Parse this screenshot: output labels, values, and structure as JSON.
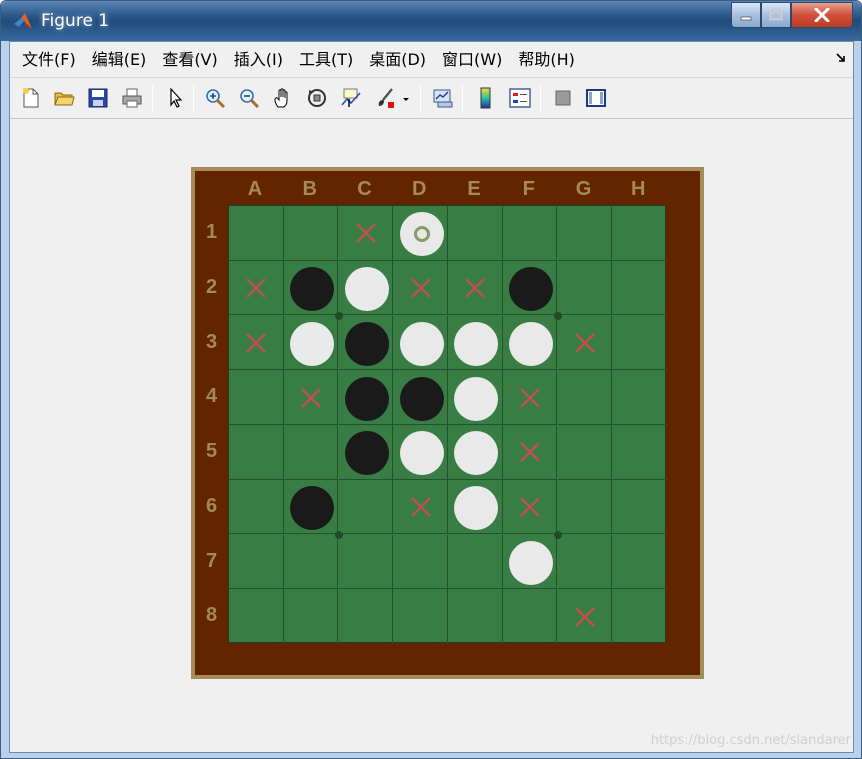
{
  "window": {
    "title": "Figure 1"
  },
  "menu": [
    {
      "id": "file",
      "label": "文件(F)"
    },
    {
      "id": "edit",
      "label": "编辑(E)"
    },
    {
      "id": "view",
      "label": "查看(V)"
    },
    {
      "id": "insert",
      "label": "插入(I)"
    },
    {
      "id": "tools",
      "label": "工具(T)"
    },
    {
      "id": "desktop",
      "label": "桌面(D)"
    },
    {
      "id": "window",
      "label": "窗口(W)"
    },
    {
      "id": "help",
      "label": "帮助(H)"
    }
  ],
  "toolbar": [
    "new-figure-icon",
    "open-file-icon",
    "save-icon",
    "print-icon",
    "pointer-icon",
    "zoom-in-icon",
    "zoom-out-icon",
    "pan-icon",
    "rotate-3d-icon",
    "data-cursor-icon",
    "brush-icon",
    "link-plot-icon",
    "colorbar-icon",
    "legend-icon",
    "hide-plot-tools-icon",
    "show-plot-tools-icon"
  ],
  "board": {
    "columns": [
      "A",
      "B",
      "C",
      "D",
      "E",
      "F",
      "G",
      "H"
    ],
    "rows": [
      "1",
      "2",
      "3",
      "4",
      "5",
      "6",
      "7",
      "8"
    ],
    "colors": {
      "frame": "#a58c5a",
      "wood": "#632400",
      "felt": "#387d44",
      "label": "#a58a55",
      "black_disc": "#1a1a1a",
      "white_disc": "#e9e9e9",
      "hint_mark": "#c0504d",
      "last_move_ring": "#8c9a6a"
    },
    "black_discs": [
      "B2",
      "F2",
      "C3",
      "C4",
      "D4",
      "C5",
      "B6"
    ],
    "white_discs": [
      "D1",
      "C2",
      "B3",
      "D3",
      "E3",
      "F3",
      "E4",
      "D5",
      "E5",
      "E6",
      "F7"
    ],
    "last_move": "D1",
    "hint_marks": [
      "C1",
      "A2",
      "D2",
      "E2",
      "A3",
      "G3",
      "B4",
      "F4",
      "F5",
      "D6",
      "F6",
      "G8"
    ]
  },
  "watermark": "https://blog.csdn.net/slandarer"
}
